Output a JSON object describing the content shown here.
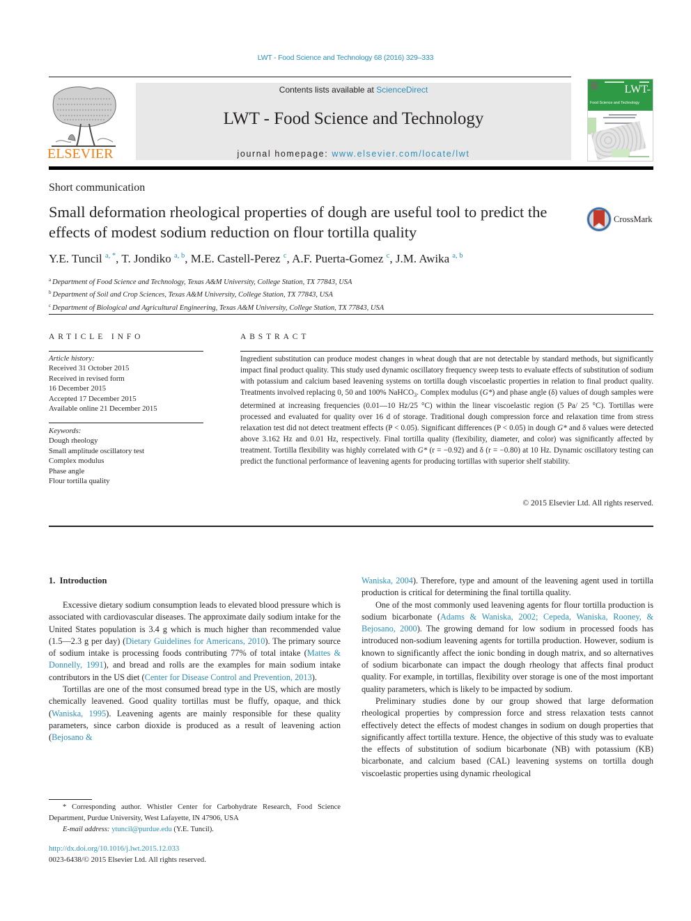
{
  "running_head": "LWT - Food Science and Technology 68 (2016) 329–333",
  "publisher": {
    "logo_name": "ELSEVIER",
    "contents_prefix": "Contents lists available at ",
    "contents_link": "ScienceDirect",
    "journal_title": "LWT - Food Science and Technology",
    "homepage_prefix": "journal homepage: ",
    "homepage_link": "www.elsevier.com/locate/lwt",
    "cover_title": "LWT-",
    "cover_subtitle": "Food Science and Technology"
  },
  "article": {
    "type": "Short communication",
    "title": "Small deformation rheological properties of dough are useful tool to predict the effects of modest sodium reduction on flour tortilla quality",
    "crossmark_label": "CrossMark",
    "authors": [
      {
        "name": "Y.E. Tuncil",
        "sup": "a, *"
      },
      {
        "name": "T. Jondiko",
        "sup": "a, b"
      },
      {
        "name": "M.E. Castell-Perez",
        "sup": "c"
      },
      {
        "name": "A.F. Puerta-Gomez",
        "sup": "c"
      },
      {
        "name": "J.M. Awika",
        "sup": "a, b"
      }
    ],
    "affiliations": [
      {
        "key": "a",
        "text": "Department of Food Science and Technology, Texas A&M University, College Station, TX 77843, USA"
      },
      {
        "key": "b",
        "text": "Department of Soil and Crop Sciences, Texas A&M University, College Station, TX 77843, USA"
      },
      {
        "key": "c",
        "text": "Department of Biological and Agricultural Engineering, Texas A&M University, College Station, TX 77843, USA"
      }
    ]
  },
  "article_info": {
    "heading": "ARTICLE INFO",
    "history_label": "Article history:",
    "history": [
      "Received 31 October 2015",
      "Received in revised form",
      "16 December 2015",
      "Accepted 17 December 2015",
      "Available online 21 December 2015"
    ],
    "keywords_label": "Keywords:",
    "keywords": [
      "Dough rheology",
      "Small amplitude oscillatory test",
      "Complex modulus",
      "Phase angle",
      "Flour tortilla quality"
    ]
  },
  "abstract": {
    "heading": "ABSTRACT",
    "parts": [
      "Ingredient substitution can produce modest changes in wheat dough that are not detectable by standard methods, but significantly impact final product quality. This study used dynamic oscillatory frequency sweep tests to evaluate effects of substitution of sodium with potassium and calcium based leavening systems on tortilla dough viscoelastic properties in relation to final product quality. Treatments involved replacing 0, 50 and 100% NaHCO",
      "3",
      ". Complex modulus (",
      "G*",
      ") and phase angle (δ) values of dough samples were determined at increasing frequencies (0.01—10 Hz/25 °C) within the linear viscoelastic region (5 Pa/ 25 °C). Tortillas were processed and evaluated for quality over 16 d of storage. Traditional dough compression force and relaxation time from stress relaxation test did not detect treatment effects (P < 0.05). Significant differences (P < 0.05) in dough ",
      "G*",
      " and δ values were detected above 3.162 Hz and 0.01 Hz, respectively. Final tortilla quality (flexibility, diameter, and color) was significantly affected by treatment. Tortilla flexibility was highly correlated with ",
      "G*",
      " (r = −0.92) and δ (r = −0.80) at 10 Hz. Dynamic oscillatory testing can predict the functional performance of leavening agents for producing tortillas with superior shelf stability."
    ],
    "copyright": "© 2015 Elsevier Ltd. All rights reserved."
  },
  "intro": {
    "heading": "1.  Introduction",
    "left_paragraphs": [
      [
        {
          "t": "Excessive dietary sodium consumption leads to elevated blood pressure which is associated with cardiovascular diseases. The approximate daily sodium intake for the United States population is 3.4 g which is much higher than recommended value (1.5—2.3 g per day) ("
        },
        {
          "link": "Dietary Guidelines for Americans, 2010"
        },
        {
          "t": "). The primary source of sodium intake is processing foods contributing 77% of total intake ("
        },
        {
          "link": "Mattes & Donnelly, 1991"
        },
        {
          "t": "), and bread and rolls are the examples for main sodium intake contributors in the US diet ("
        },
        {
          "link": "Center for Disease Control and Prevention, 2013"
        },
        {
          "t": ")."
        }
      ],
      [
        {
          "t": "Tortillas are one of the most consumed bread type in the US, which are mostly chemically leavened. Good quality tortillas must be fluffy, opaque, and thick ("
        },
        {
          "link": "Waniska, 1995"
        },
        {
          "t": "). Leavening agents are mainly responsible for these quality parameters, since carbon dioxide is produced as a result of leavening action ("
        },
        {
          "link": "Bejosano &"
        }
      ]
    ],
    "right_paragraphs": [
      [
        {
          "link": "Waniska, 2004"
        },
        {
          "t": "). Therefore, type and amount of the leavening agent used in tortilla production is critical for determining the final tortilla quality."
        }
      ],
      [
        {
          "t": "One of the most commonly used leavening agents for flour tortilla production is sodium bicarbonate ("
        },
        {
          "link": "Adams & Waniska, 2002; Cepeda, Waniska, Rooney, & Bejosano, 2000"
        },
        {
          "t": "). The growing demand for low sodium in processed foods has introduced non-sodium leavening agents for tortilla production. However, sodium is known to significantly affect the ionic bonding in dough matrix, and so alternatives of sodium bicarbonate can impact the dough rheology that affects final product quality. For example, in tortillas, flexibility over storage is one of the most important quality parameters, which is likely to be impacted by sodium."
        }
      ],
      [
        {
          "t": "Preliminary studies done by our group showed that large deformation rheological properties by compression force and stress relaxation tests cannot effectively detect the effects of modest changes in sodium on dough properties that significantly affect tortilla texture. Hence, the objective of this study was to evaluate the effects of substitution of sodium bicarbonate (NB) with potassium (KB) bicarbonate, and calcium based (CAL) leavening systems on tortilla dough viscoelastic properties using dynamic rheological"
        }
      ]
    ]
  },
  "footnote": {
    "marker": "*",
    "text": "Corresponding author. Whistler Center for Carbohydrate Research, Food Science Department, Purdue University, West Lafayette, IN 47906, USA",
    "email_label": "E-mail address:",
    "email": "ytuncil@purdue.edu",
    "email_suffix": " (Y.E. Tuncil)."
  },
  "doi": "http://dx.doi.org/10.1016/j.lwt.2015.12.033",
  "issn_copyright": "0023-6438/© 2015 Elsevier Ltd. All rights reserved.",
  "colors": {
    "link": "#2a8fb9",
    "elsevier_orange": "#f07f12",
    "masthead_gray": "#e8e8e8",
    "cover_green": "#2f9a46",
    "crossmark_red": "#c0392b"
  }
}
